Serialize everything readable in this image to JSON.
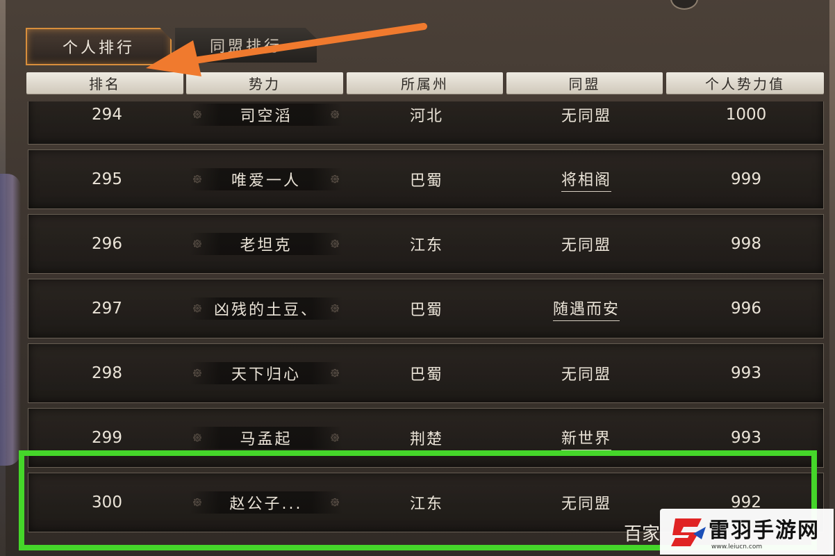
{
  "tabs": [
    {
      "label": "个人排行",
      "active": true
    },
    {
      "label": "同盟排行",
      "active": false
    }
  ],
  "headers": [
    "排名",
    "势力",
    "所属州",
    "同盟",
    "个人势力值"
  ],
  "rows": [
    {
      "rank": "294",
      "name": "司空滔",
      "state": "河北",
      "alliance": "无同盟",
      "power": "1000",
      "alliance_link": false
    },
    {
      "rank": "295",
      "name": "唯爱一人",
      "state": "巴蜀",
      "alliance": "将相阁",
      "power": "999",
      "alliance_link": true
    },
    {
      "rank": "296",
      "name": "老坦克",
      "state": "江东",
      "alliance": "无同盟",
      "power": "998",
      "alliance_link": false
    },
    {
      "rank": "297",
      "name": "凶残的土豆、",
      "state": "巴蜀",
      "alliance": "随遇而安",
      "power": "996",
      "alliance_link": true
    },
    {
      "rank": "298",
      "name": "天下归心",
      "state": "巴蜀",
      "alliance": "无同盟",
      "power": "993",
      "alliance_link": false
    },
    {
      "rank": "299",
      "name": "马孟起",
      "state": "荆楚",
      "alliance": "新世界",
      "power": "993",
      "alliance_link": true
    },
    {
      "rank": "300",
      "name": "赵公子...",
      "state": "江东",
      "alliance": "无同盟",
      "power": "992",
      "alliance_link": false
    }
  ],
  "colors": {
    "highlight": "#45d62a",
    "arrow": "#f07a2e",
    "tab_border": "#d88e3c",
    "watermark_red": "#e02424"
  },
  "icons": [
    "swirl-ornament-icon",
    "arrow-annotation-icon",
    "leiyu-logo-icon"
  ],
  "watermark": {
    "partial_text": "百家",
    "title": "雷羽手游网",
    "url": "www.leiucn.com"
  }
}
